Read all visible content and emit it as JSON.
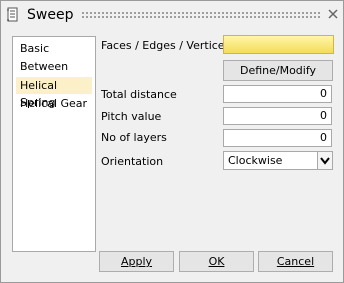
{
  "dialog": {
    "title": "Sweep"
  },
  "types": [
    {
      "label": "Basic",
      "selected": false
    },
    {
      "label": "Between",
      "selected": false
    },
    {
      "label": "Helical Spring",
      "selected": true
    },
    {
      "label": "Helical Gear",
      "selected": false
    }
  ],
  "form": {
    "faces_label": "Faces / Edges / Vertices",
    "define_button": "Define/Modify Axis...",
    "total_distance_label": "Total distance",
    "total_distance_value": "0",
    "pitch_label": "Pitch value",
    "pitch_value": "0",
    "layers_label": "No of layers",
    "layers_value": "0",
    "orientation_label": "Orientation",
    "orientation_value": "Clockwise"
  },
  "buttons": {
    "apply": "Apply",
    "ok": "OK",
    "cancel": "Cancel"
  },
  "colors": {
    "selection_highlight": "#fcf0c8",
    "active_field": "#f7e27a"
  }
}
